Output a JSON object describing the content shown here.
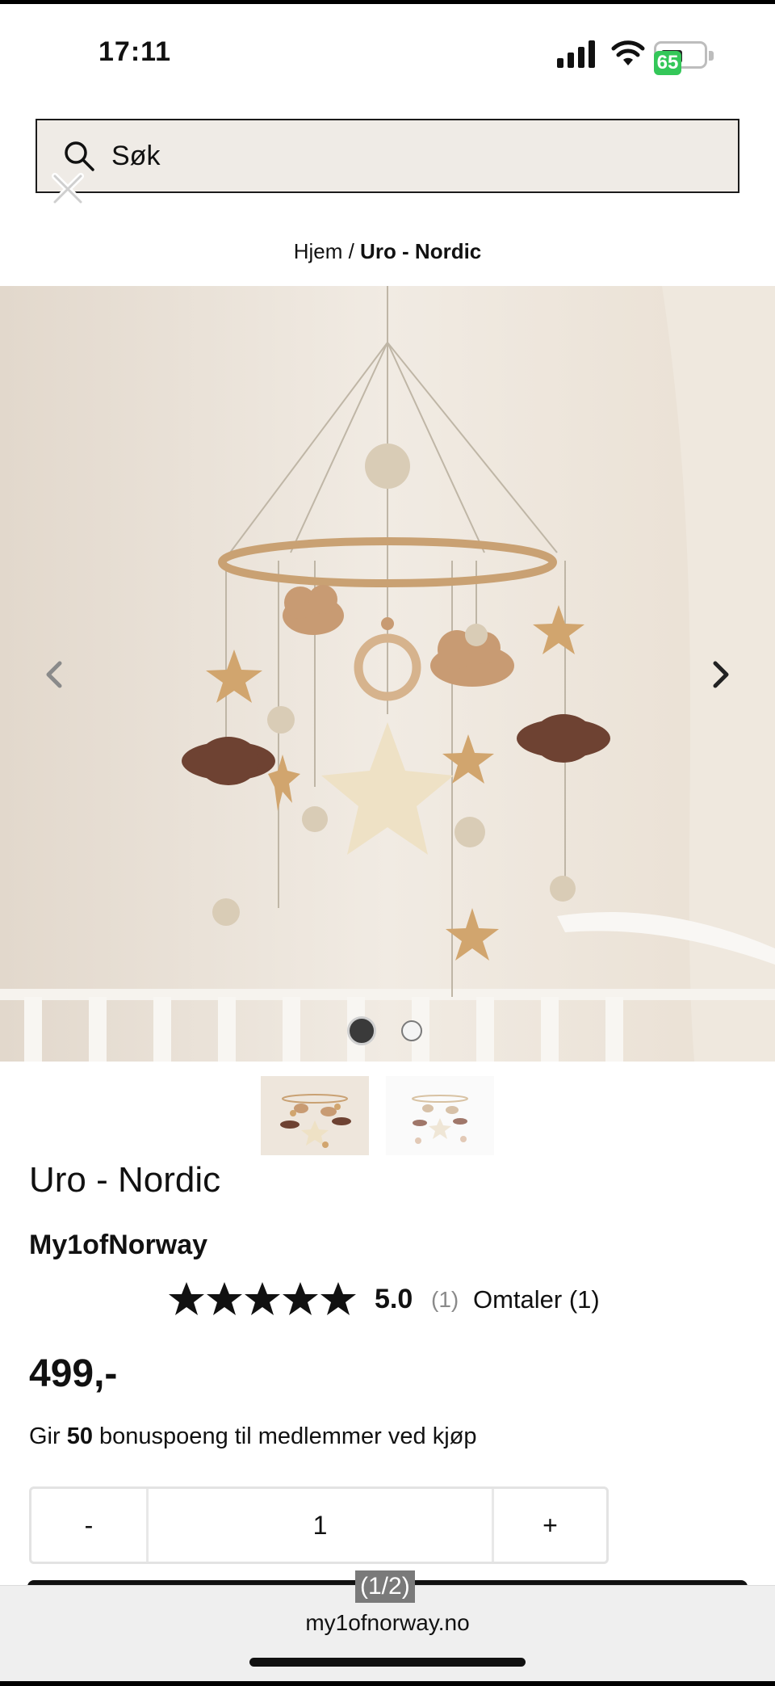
{
  "status_bar": {
    "time": "17:11",
    "battery_percent": "65",
    "icons": [
      "signal-icon",
      "wifi-icon",
      "battery-icon"
    ]
  },
  "search": {
    "placeholder": "Søk",
    "icon": "search-icon",
    "close_icon": "close-icon"
  },
  "breadcrumb": {
    "home": "Hjem",
    "separator": " / ",
    "current": "Uro - Nordic"
  },
  "gallery": {
    "image_count": 2,
    "active_index": 1,
    "prev_icon": "chevron-left-icon",
    "next_icon": "chevron-right-icon"
  },
  "product": {
    "title": "Uro - Nordic",
    "brand": "My1ofNorway",
    "rating_value": "5.0",
    "rating_stars": 5,
    "rating_count": "(1)",
    "reviews_link": "Omtaler (1)",
    "price": "499,-",
    "bonus_prefix": "Gir ",
    "bonus_points": "50",
    "bonus_suffix": " bonuspoeng til medlemmer ved kjøp"
  },
  "quantity": {
    "minus_label": "-",
    "value": "1",
    "plus_label": "+"
  },
  "browser": {
    "page_counter": "(1/2)",
    "url": "my1ofnorway.no"
  },
  "colors": {
    "search_bg": "#efebe6",
    "text": "#111111",
    "battery_green": "#34c759"
  }
}
